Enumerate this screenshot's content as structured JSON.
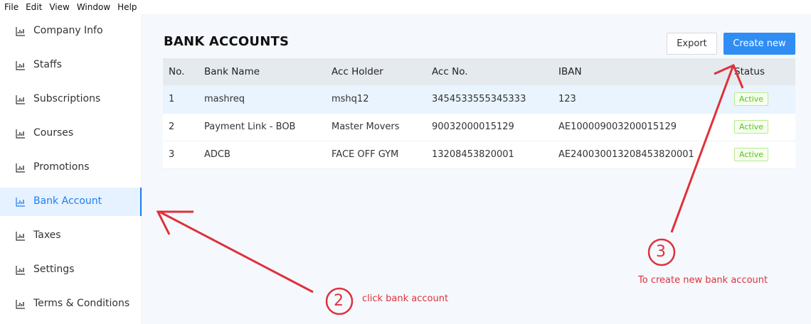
{
  "menu": [
    "File",
    "Edit",
    "View",
    "Window",
    "Help"
  ],
  "sidebar": {
    "items": [
      {
        "label": "Company Info"
      },
      {
        "label": "Staffs"
      },
      {
        "label": "Subscriptions"
      },
      {
        "label": "Courses"
      },
      {
        "label": "Promotions"
      },
      {
        "label": "Bank Account"
      },
      {
        "label": "Taxes"
      },
      {
        "label": "Settings"
      },
      {
        "label": "Terms & Conditions"
      }
    ],
    "active_index": 5,
    "icon": "chart-icon"
  },
  "page": {
    "title": "BANK ACCOUNTS",
    "export_label": "Export",
    "create_label": "Create new"
  },
  "table": {
    "headers": [
      "No.",
      "Bank Name",
      "Acc Holder",
      "Acc No.",
      "IBAN",
      "Status"
    ],
    "rows": [
      [
        "1",
        "mashreq",
        "mshq12",
        "3454533555345333",
        "123",
        "Active"
      ],
      [
        "2",
        "Payment Link - BOB",
        "Master Movers",
        "90032000015129",
        "AE100009003200015129",
        "Active"
      ],
      [
        "3",
        "ADCB",
        "FACE OFF GYM",
        "13208453820001",
        "AE240030013208453820001",
        "Active"
      ]
    ]
  },
  "annotations": {
    "step2": {
      "number": "2",
      "text": "click bank account"
    },
    "step3": {
      "number": "3",
      "text": "To create new bank account"
    },
    "color": "#e0303a"
  },
  "colors": {
    "accent": "#2f8df4",
    "active_text": "#1e7ff0",
    "status_green": "#52c41a"
  }
}
